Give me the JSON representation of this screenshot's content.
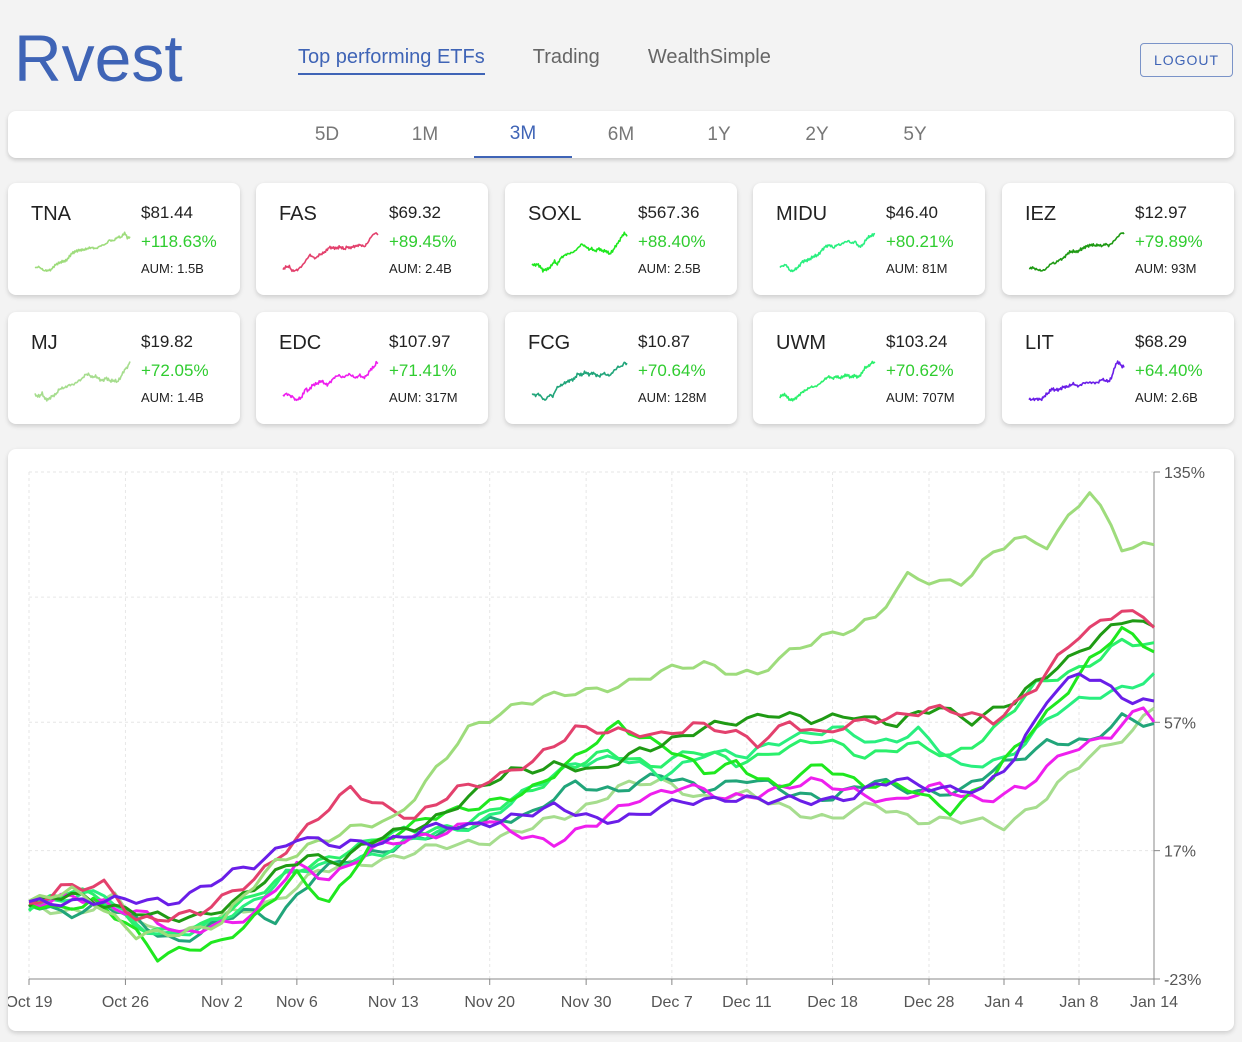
{
  "app": {
    "logo_text": "Rvest",
    "brand_color": "#3f64b6"
  },
  "nav": {
    "items": [
      {
        "label": "Top performing ETFs",
        "active": true
      },
      {
        "label": "Trading",
        "active": false
      },
      {
        "label": "WealthSimple",
        "active": false
      }
    ],
    "logout_label": "LOGOUT"
  },
  "periods": {
    "items": [
      "5D",
      "1M",
      "3M",
      "6M",
      "1Y",
      "2Y",
      "5Y"
    ],
    "active": "3M"
  },
  "etfs": [
    {
      "symbol": "TNA",
      "price": "$81.44",
      "change": "+118.63%",
      "aum": "AUM: 1.5B",
      "color": "#9edc7c"
    },
    {
      "symbol": "FAS",
      "price": "$69.32",
      "change": "+89.45%",
      "aum": "AUM: 2.4B",
      "color": "#e3416d"
    },
    {
      "symbol": "SOXL",
      "price": "$567.36",
      "change": "+88.40%",
      "aum": "AUM: 2.5B",
      "color": "#1fe81f"
    },
    {
      "symbol": "MIDU",
      "price": "$46.40",
      "change": "+80.21%",
      "aum": "AUM: 81M",
      "color": "#29ef7f"
    },
    {
      "symbol": "IEZ",
      "price": "$12.97",
      "change": "+79.89%",
      "aum": "AUM: 93M",
      "color": "#1f9a14"
    },
    {
      "symbol": "MJ",
      "price": "$19.82",
      "change": "+72.05%",
      "aum": "AUM: 1.4B",
      "color": "#a6dd8e"
    },
    {
      "symbol": "EDC",
      "price": "$107.97",
      "change": "+71.41%",
      "aum": "AUM: 317M",
      "color": "#ee1fee"
    },
    {
      "symbol": "FCG",
      "price": "$10.87",
      "change": "+70.64%",
      "aum": "AUM: 128M",
      "color": "#21a57a"
    },
    {
      "symbol": "UWM",
      "price": "$103.24",
      "change": "+70.62%",
      "aum": "AUM: 707M",
      "color": "#2bf06c"
    },
    {
      "symbol": "LIT",
      "price": "$68.29",
      "change": "+64.40%",
      "aum": "AUM: 2.6B",
      "color": "#6a1ee8"
    }
  ],
  "chart_data": {
    "type": "line",
    "x_ticks": [
      "Oct 19",
      "Oct 26",
      "Nov 2",
      "Nov 6",
      "Nov 13",
      "Nov 20",
      "Nov 30",
      "Dec 7",
      "Dec 11",
      "Dec 18",
      "Dec 28",
      "Jan 4",
      "Jan 8",
      "Jan 14"
    ],
    "y_ticks": [
      "135%",
      "57%",
      "17%",
      "-23%"
    ],
    "ylim": [
      -23,
      135
    ],
    "grid": true,
    "n_points": 63,
    "series": [
      {
        "name": "TNA",
        "values": [
          0,
          4,
          5,
          4,
          5,
          3,
          2,
          1,
          -1,
          -2,
          -6,
          -9,
          -10,
          -11,
          -9,
          -7,
          -5,
          -2,
          0,
          3,
          7,
          10,
          13,
          16,
          18,
          17,
          19,
          21,
          24,
          26,
          28,
          25,
          23,
          22,
          24,
          26,
          29,
          28,
          33,
          36,
          40,
          46,
          52,
          57,
          59,
          62,
          66,
          69,
          68,
          67,
          72,
          75,
          77,
          75,
          70,
          73,
          80,
          93,
          108,
          118,
          121,
          128,
          119
        ],
        "anchors": [
          [
            0,
            0
          ],
          [
            4,
            5
          ],
          [
            6,
            2
          ],
          [
            10,
            -10
          ],
          [
            13,
            -9
          ],
          [
            18,
            -5
          ],
          [
            23,
            13
          ],
          [
            26,
            19
          ],
          [
            34,
            27
          ],
          [
            41,
            54
          ],
          [
            46,
            64
          ],
          [
            52,
            66
          ],
          [
            57,
            71
          ],
          [
            63,
            75
          ],
          [
            68,
            72
          ],
          [
            74,
            84
          ],
          [
            79,
            89
          ],
          [
            82,
            102
          ],
          [
            87,
            101
          ],
          [
            92,
            114
          ],
          [
            95,
            113
          ],
          [
            99,
            129
          ],
          [
            102,
            111
          ],
          [
            105,
            113
          ]
        ]
      },
      {
        "name": "FAS",
        "values": [
          0,
          3,
          5,
          6,
          5,
          2,
          -4,
          -4
        ],
        "anchors": [
          [
            0,
            0
          ],
          [
            3,
            6
          ],
          [
            5,
            5
          ],
          [
            7,
            6
          ],
          [
            10,
            -4
          ],
          [
            16,
            -3
          ],
          [
            21,
            9
          ],
          [
            25,
            20
          ],
          [
            30,
            37
          ],
          [
            33,
            31
          ],
          [
            36,
            26
          ],
          [
            40,
            37
          ],
          [
            44,
            40
          ],
          [
            47,
            44
          ],
          [
            51,
            56
          ],
          [
            56,
            53
          ],
          [
            59,
            53
          ],
          [
            62,
            57
          ],
          [
            65,
            54
          ],
          [
            68,
            50
          ],
          [
            71,
            58
          ],
          [
            74,
            53
          ],
          [
            77,
            56
          ],
          [
            80,
            59
          ],
          [
            84,
            61
          ],
          [
            90,
            58
          ],
          [
            94,
            68
          ],
          [
            98,
            84
          ],
          [
            102,
            93
          ],
          [
            105,
            87
          ]
        ]
      },
      {
        "name": "SOXL",
        "anchors": [
          [
            0,
            0
          ],
          [
            3,
            -2
          ],
          [
            6,
            2
          ],
          [
            9,
            -5
          ],
          [
            12,
            -17
          ],
          [
            15,
            -13
          ],
          [
            18,
            -11
          ],
          [
            21,
            -5
          ],
          [
            25,
            10
          ],
          [
            28,
            1
          ],
          [
            32,
            18
          ],
          [
            37,
            28
          ],
          [
            42,
            30
          ],
          [
            47,
            37
          ],
          [
            51,
            45
          ],
          [
            55,
            57
          ],
          [
            60,
            48
          ],
          [
            63,
            41
          ],
          [
            66,
            45
          ],
          [
            70,
            36
          ],
          [
            74,
            44
          ],
          [
            78,
            38
          ],
          [
            82,
            36
          ],
          [
            86,
            30
          ],
          [
            90,
            40
          ],
          [
            95,
            60
          ],
          [
            99,
            76
          ],
          [
            102,
            85
          ],
          [
            105,
            80
          ]
        ]
      },
      {
        "name": "MIDU",
        "anchors": [
          [
            0,
            0
          ],
          [
            4,
            3
          ],
          [
            7,
            3
          ],
          [
            10,
            -6
          ],
          [
            13,
            -9
          ],
          [
            16,
            -8
          ],
          [
            20,
            -1
          ],
          [
            24,
            10
          ],
          [
            28,
            12
          ],
          [
            33,
            17
          ],
          [
            38,
            22
          ],
          [
            42,
            26
          ],
          [
            47,
            36
          ],
          [
            51,
            45
          ],
          [
            55,
            46
          ],
          [
            59,
            40
          ],
          [
            63,
            48
          ],
          [
            67,
            46
          ],
          [
            71,
            53
          ],
          [
            75,
            55
          ],
          [
            79,
            50
          ],
          [
            83,
            55
          ],
          [
            87,
            42
          ],
          [
            91,
            46
          ],
          [
            96,
            60
          ],
          [
            100,
            66
          ],
          [
            105,
            71
          ]
        ]
      },
      {
        "name": "IEZ",
        "anchors": [
          [
            0,
            0
          ],
          [
            4,
            3
          ],
          [
            7,
            1
          ],
          [
            10,
            -2
          ],
          [
            13,
            -5
          ],
          [
            16,
            -3
          ],
          [
            19,
            1
          ],
          [
            22,
            7
          ],
          [
            26,
            16
          ],
          [
            29,
            14
          ],
          [
            33,
            21
          ],
          [
            37,
            26
          ],
          [
            41,
            33
          ],
          [
            45,
            42
          ],
          [
            49,
            44
          ],
          [
            53,
            41
          ],
          [
            57,
            49
          ],
          [
            61,
            52
          ],
          [
            65,
            57
          ],
          [
            69,
            60
          ],
          [
            73,
            57
          ],
          [
            77,
            60
          ],
          [
            81,
            56
          ],
          [
            85,
            62
          ],
          [
            88,
            58
          ],
          [
            92,
            63
          ],
          [
            96,
            75
          ],
          [
            100,
            84
          ],
          [
            103,
            89
          ],
          [
            105,
            86
          ]
        ]
      },
      {
        "name": "MJ",
        "anchors": [
          [
            0,
            0
          ],
          [
            5,
            -2
          ],
          [
            8,
            2
          ],
          [
            11,
            -7
          ],
          [
            15,
            -8
          ],
          [
            19,
            -3
          ],
          [
            23,
            2
          ],
          [
            27,
            10
          ],
          [
            32,
            14
          ],
          [
            37,
            17
          ],
          [
            42,
            20
          ],
          [
            47,
            24
          ],
          [
            51,
            29
          ],
          [
            55,
            37
          ],
          [
            59,
            38
          ],
          [
            63,
            34
          ],
          [
            67,
            34
          ],
          [
            71,
            30
          ],
          [
            75,
            27
          ],
          [
            79,
            31
          ],
          [
            83,
            27
          ],
          [
            87,
            26
          ],
          [
            91,
            25
          ],
          [
            95,
            34
          ],
          [
            99,
            46
          ],
          [
            103,
            55
          ],
          [
            105,
            62
          ]
        ]
      },
      {
        "name": "EDC",
        "anchors": [
          [
            0,
            0
          ],
          [
            4,
            2
          ],
          [
            7,
            1
          ],
          [
            11,
            -3
          ],
          [
            14,
            -10
          ],
          [
            17,
            -6
          ],
          [
            21,
            -3
          ],
          [
            25,
            12
          ],
          [
            28,
            9
          ],
          [
            32,
            17
          ],
          [
            37,
            22
          ],
          [
            42,
            26
          ],
          [
            46,
            22
          ],
          [
            49,
            20
          ],
          [
            53,
            25
          ],
          [
            57,
            34
          ],
          [
            61,
            37
          ],
          [
            65,
            33
          ],
          [
            69,
            36
          ],
          [
            73,
            38
          ],
          [
            77,
            36
          ],
          [
            81,
            32
          ],
          [
            85,
            37
          ],
          [
            89,
            33
          ],
          [
            93,
            36
          ],
          [
            97,
            49
          ],
          [
            101,
            53
          ],
          [
            104,
            61
          ],
          [
            105,
            58
          ]
        ]
      },
      {
        "name": "FCG",
        "anchors": [
          [
            0,
            0
          ],
          [
            4,
            -2
          ],
          [
            7,
            0
          ],
          [
            11,
            -7
          ],
          [
            14,
            -11
          ],
          [
            17,
            -7
          ],
          [
            20,
            -2
          ],
          [
            23,
            -4
          ],
          [
            27,
            10
          ],
          [
            31,
            15
          ],
          [
            35,
            20
          ],
          [
            39,
            22
          ],
          [
            43,
            27
          ],
          [
            47,
            28
          ],
          [
            51,
            38
          ],
          [
            55,
            36
          ],
          [
            59,
            40
          ],
          [
            63,
            37
          ],
          [
            67,
            39
          ],
          [
            71,
            35
          ],
          [
            75,
            34
          ],
          [
            79,
            38
          ],
          [
            83,
            36
          ],
          [
            87,
            35
          ],
          [
            91,
            44
          ],
          [
            95,
            51
          ],
          [
            99,
            50
          ],
          [
            102,
            59
          ],
          [
            105,
            57
          ]
        ]
      },
      {
        "name": "UWM",
        "anchors": [
          [
            0,
            0
          ],
          [
            4,
            4
          ],
          [
            7,
            2
          ],
          [
            10,
            -6
          ],
          [
            13,
            -9
          ],
          [
            16,
            -7
          ],
          [
            19,
            0
          ],
          [
            22,
            5
          ],
          [
            26,
            12
          ],
          [
            30,
            18
          ],
          [
            34,
            22
          ],
          [
            38,
            24
          ],
          [
            42,
            27
          ],
          [
            46,
            34
          ],
          [
            50,
            43
          ],
          [
            54,
            47
          ],
          [
            58,
            44
          ],
          [
            62,
            48
          ],
          [
            66,
            44
          ],
          [
            70,
            49
          ],
          [
            74,
            51
          ],
          [
            78,
            47
          ],
          [
            82,
            50
          ],
          [
            86,
            46
          ],
          [
            90,
            55
          ],
          [
            94,
            68
          ],
          [
            98,
            74
          ],
          [
            102,
            82
          ],
          [
            105,
            80
          ]
        ]
      },
      {
        "name": "LIT",
        "anchors": [
          [
            0,
            0
          ],
          [
            5,
            2
          ],
          [
            9,
            1
          ],
          [
            13,
            1
          ],
          [
            17,
            7
          ],
          [
            21,
            12
          ],
          [
            25,
            22
          ],
          [
            29,
            18
          ],
          [
            33,
            20
          ],
          [
            37,
            24
          ],
          [
            41,
            24
          ],
          [
            45,
            28
          ],
          [
            49,
            30
          ],
          [
            53,
            27
          ],
          [
            57,
            28
          ],
          [
            61,
            32
          ],
          [
            65,
            34
          ],
          [
            69,
            32
          ],
          [
            73,
            33
          ],
          [
            77,
            34
          ],
          [
            81,
            39
          ],
          [
            85,
            37
          ],
          [
            89,
            35
          ],
          [
            92,
            46
          ],
          [
            95,
            65
          ],
          [
            98,
            72
          ],
          [
            101,
            67
          ],
          [
            103,
            64
          ],
          [
            105,
            64
          ]
        ]
      }
    ]
  }
}
